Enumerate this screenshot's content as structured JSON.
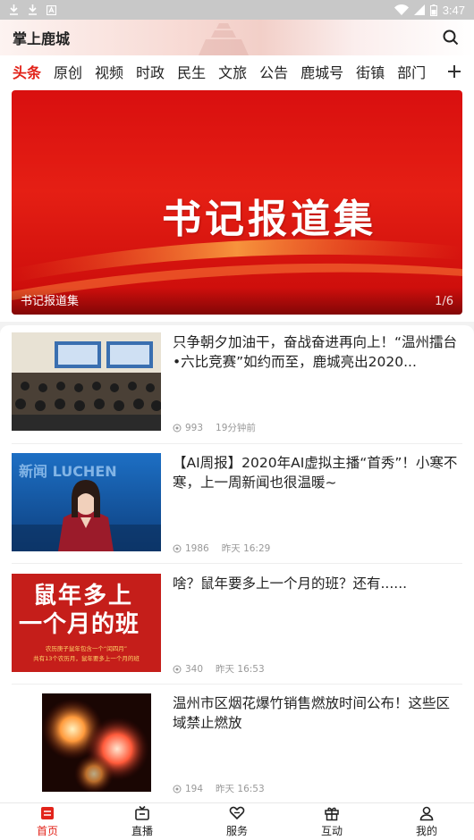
{
  "statusbar": {
    "time": "3:47",
    "icons": [
      "download-icon",
      "download-icon",
      "notification-icon",
      "wifi-icon",
      "signal-icon",
      "battery-icon"
    ]
  },
  "header": {
    "app_title": "掌上鹿城",
    "search_icon": "search-icon"
  },
  "tabs": [
    {
      "label": "头条",
      "active": true
    },
    {
      "label": "原创"
    },
    {
      "label": "视频"
    },
    {
      "label": "时政"
    },
    {
      "label": "民生"
    },
    {
      "label": "文旅"
    },
    {
      "label": "公告"
    },
    {
      "label": "鹿城号"
    },
    {
      "label": "街镇"
    },
    {
      "label": "部门"
    }
  ],
  "banner": {
    "headline": "书记报道集",
    "caption": "书记报道集",
    "counter": "1/6"
  },
  "feed": [
    {
      "title": "只争朝夕加油干，奋战奋进再向上！“温州擂台•六比竞赛”如约而至，鹿城亮出2020...",
      "views": "993",
      "time": "19分钟前"
    },
    {
      "title": "【AI周报】2020年AI虚拟主播“首秀”！小寒不寒，上一周新闻也很温暖~",
      "views": "1986",
      "time": "昨天 16:29",
      "thumb_text": "鹿城新闻 LUCHEN"
    },
    {
      "title": "啥？鼠年要多上一个月的班？还有......",
      "views": "340",
      "time": "昨天 16:53",
      "thumb_line1": "鼠年多上",
      "thumb_line2": "一个月的班",
      "thumb_small1": "农历庚子鼠年包含一个“闰四月”",
      "thumb_small2": "共有13个农历月，鼠年要多上一个月的班"
    },
    {
      "title": "温州市区烟花爆竹销售燃放时间公布！这些区域禁止燃放",
      "views": "194",
      "time": "昨天 16:53"
    }
  ],
  "bottom_nav": [
    {
      "label": "首页",
      "icon": "home-icon",
      "active": true
    },
    {
      "label": "直播",
      "icon": "tv-icon"
    },
    {
      "label": "服务",
      "icon": "heart-hand-icon"
    },
    {
      "label": "互动",
      "icon": "gift-icon"
    },
    {
      "label": "我的",
      "icon": "user-icon"
    }
  ],
  "colors": {
    "accent": "#e2231a",
    "statusbar": "#c8c8c8",
    "text": "#222222",
    "meta": "#999999"
  }
}
